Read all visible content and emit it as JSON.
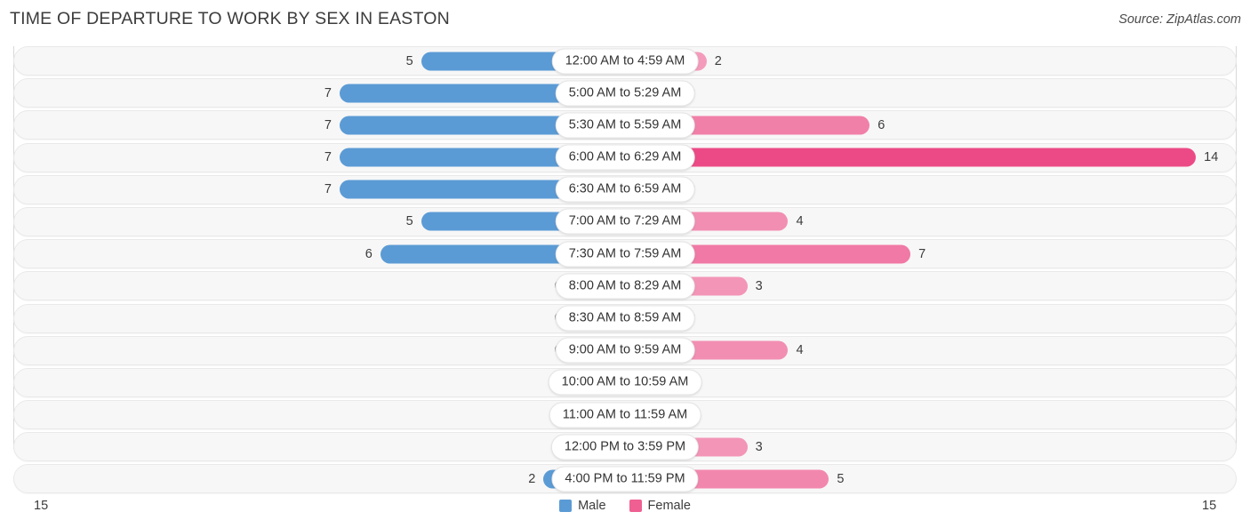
{
  "header": {
    "title": "TIME OF DEPARTURE TO WORK BY SEX IN EASTON",
    "source": "Source: ZipAtlas.com"
  },
  "legend": {
    "male_label": "Male",
    "female_label": "Female",
    "male_color": "#5b9bd5",
    "female_color": "#ef5f92"
  },
  "axis": {
    "left_max": "15",
    "right_max": "15"
  },
  "chart_data": {
    "type": "bar",
    "title": "TIME OF DEPARTURE TO WORK BY SEX IN EASTON",
    "subtitle": "Source: ZipAtlas.com",
    "orientation": "horizontal-diverging",
    "xlabel": "",
    "ylabel": "",
    "xlim": [
      -15,
      15
    ],
    "axis_max": 15,
    "grid": false,
    "legend_position": "bottom-center",
    "categories": [
      "12:00 AM to 4:59 AM",
      "5:00 AM to 5:29 AM",
      "5:30 AM to 5:59 AM",
      "6:00 AM to 6:29 AM",
      "6:30 AM to 6:59 AM",
      "7:00 AM to 7:29 AM",
      "7:30 AM to 7:59 AM",
      "8:00 AM to 8:29 AM",
      "8:30 AM to 8:59 AM",
      "9:00 AM to 9:59 AM",
      "10:00 AM to 10:59 AM",
      "11:00 AM to 11:59 AM",
      "12:00 PM to 3:59 PM",
      "4:00 PM to 11:59 PM"
    ],
    "series": [
      {
        "name": "Male",
        "values": [
          5,
          7,
          7,
          7,
          7,
          5,
          6,
          0,
          0,
          0,
          0,
          0,
          0,
          2
        ]
      },
      {
        "name": "Female",
        "values": [
          2,
          0,
          6,
          14,
          0,
          4,
          7,
          3,
          0,
          4,
          0,
          0,
          3,
          5
        ]
      }
    ]
  },
  "rows": [
    {
      "label": "12:00 AM to 4:59 AM",
      "male": "5",
      "female": "2"
    },
    {
      "label": "5:00 AM to 5:29 AM",
      "male": "7",
      "female": "0"
    },
    {
      "label": "5:30 AM to 5:59 AM",
      "male": "7",
      "female": "6"
    },
    {
      "label": "6:00 AM to 6:29 AM",
      "male": "7",
      "female": "14"
    },
    {
      "label": "6:30 AM to 6:59 AM",
      "male": "7",
      "female": "0"
    },
    {
      "label": "7:00 AM to 7:29 AM",
      "male": "5",
      "female": "4"
    },
    {
      "label": "7:30 AM to 7:59 AM",
      "male": "6",
      "female": "7"
    },
    {
      "label": "8:00 AM to 8:29 AM",
      "male": "0",
      "female": "3"
    },
    {
      "label": "8:30 AM to 8:59 AM",
      "male": "0",
      "female": "0"
    },
    {
      "label": "9:00 AM to 9:59 AM",
      "male": "0",
      "female": "4"
    },
    {
      "label": "10:00 AM to 10:59 AM",
      "male": "0",
      "female": "0"
    },
    {
      "label": "11:00 AM to 11:59 AM",
      "male": "0",
      "female": "0"
    },
    {
      "label": "12:00 PM to 3:59 PM",
      "male": "0",
      "female": "3"
    },
    {
      "label": "4:00 PM to 11:59 PM",
      "male": "2",
      "female": "5"
    }
  ]
}
